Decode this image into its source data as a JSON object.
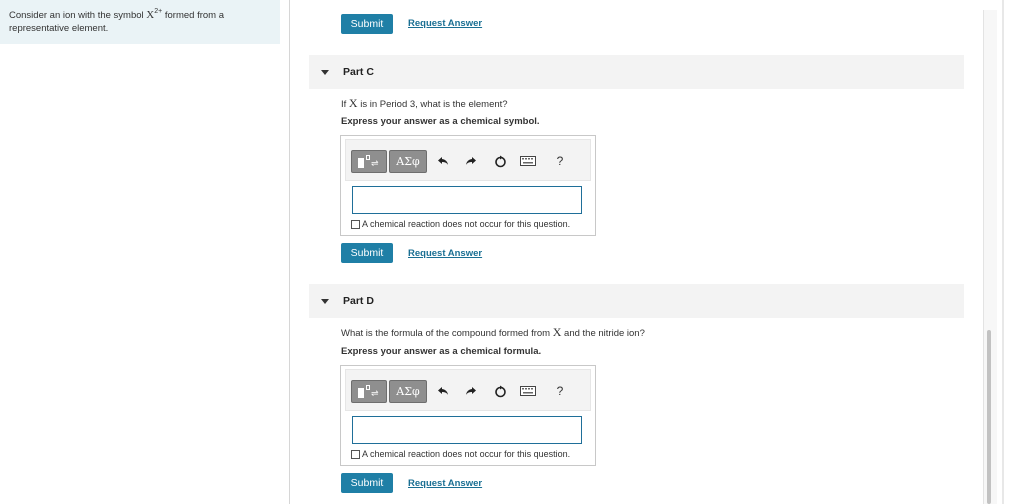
{
  "sidebar": {
    "prompt_prefix": "Consider an ion with the symbol ",
    "prompt_symbol": "X",
    "prompt_charge": "2+",
    "prompt_suffix": " formed from a representative element."
  },
  "top_actions": {
    "submit_label": "Submit",
    "request_label": "Request Answer"
  },
  "parts": [
    {
      "title": "Part C",
      "question_prefix": "If ",
      "question_symbol": "X",
      "question_suffix": " is in Period 3, what is the element?",
      "instruction": "Express your answer as a chemical symbol.",
      "answer_value": "",
      "no_reaction_label": "A chemical reaction does not occur for this question.",
      "submit_label": "Submit",
      "request_label": "Request Answer"
    },
    {
      "title": "Part D",
      "question_prefix": "What is the formula of the compound formed from ",
      "question_symbol": "X",
      "question_suffix": " and the nitride ion?",
      "instruction": "Express your answer as a chemical formula.",
      "answer_value": "",
      "no_reaction_label": "A chemical reaction does not occur for this question.",
      "submit_label": "Submit",
      "request_label": "Request Answer"
    }
  ],
  "toolbar": {
    "greek_label": "ΑΣφ",
    "help_label": "?",
    "icons": [
      "templates-icon",
      "greek-symbols-icon",
      "undo-icon",
      "redo-icon",
      "reset-icon",
      "keyboard-icon",
      "help-icon"
    ]
  },
  "colors": {
    "accent": "#1f7fa6",
    "link": "#1a6f93",
    "prompt_bg": "#eaf3f6",
    "header_bg": "#f3f3f3"
  }
}
